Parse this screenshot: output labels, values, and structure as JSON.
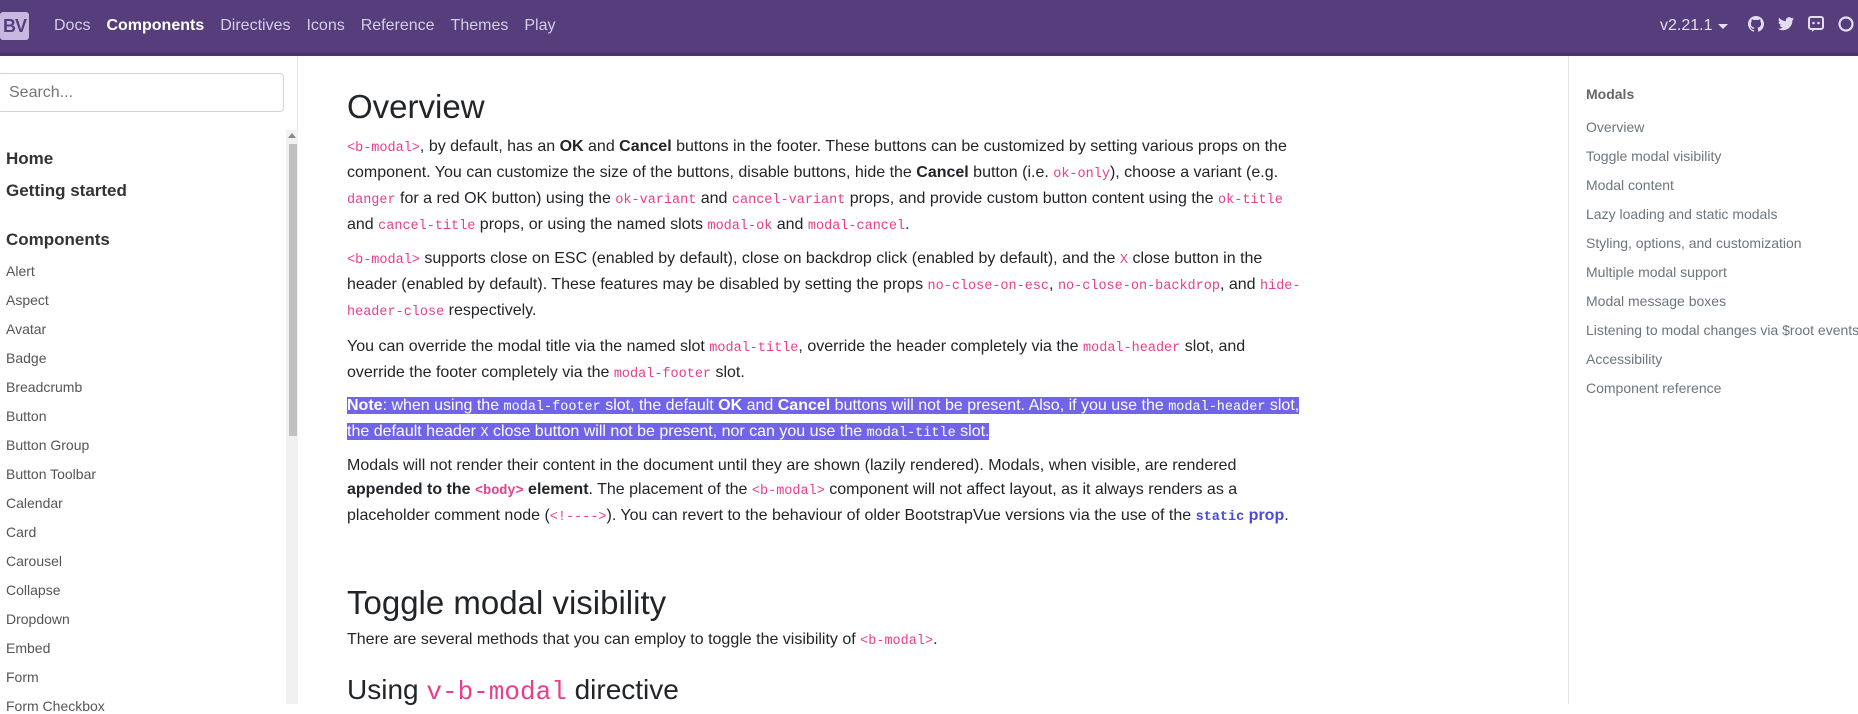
{
  "navbar": {
    "brand": "BV",
    "links": [
      "Docs",
      "Components",
      "Directives",
      "Icons",
      "Reference",
      "Themes",
      "Play"
    ],
    "active_link": "Components",
    "version": "v2.21.1",
    "icons": [
      "github-icon",
      "twitter-icon",
      "discord-icon",
      "opencollective-icon"
    ]
  },
  "sidebar": {
    "search_placeholder": "Search...",
    "top_links": [
      "Home",
      "Getting started"
    ],
    "section_title": "Components",
    "items": [
      "Alert",
      "Aspect",
      "Avatar",
      "Badge",
      "Breadcrumb",
      "Button",
      "Button Group",
      "Button Toolbar",
      "Calendar",
      "Card",
      "Carousel",
      "Collapse",
      "Dropdown",
      "Embed",
      "Form",
      "Form Checkbox"
    ]
  },
  "content": {
    "overview_title": "Overview",
    "p1": {
      "c_b_modal": "<b-modal>",
      "t1": ", by default, has an ",
      "ok": "OK",
      "and": " and ",
      "cancel": "Cancel",
      "t2": " buttons in the footer. These buttons can be customized by setting various props on the component. You can customize the size of the buttons, disable buttons, hide the ",
      "cancel2": "Cancel",
      "t3": " button (i.e. ",
      "c_ok_only": "ok-only",
      "t4": "), choose a variant (e.g. ",
      "c_danger": "danger",
      "t5": " for a red OK button) using the ",
      "c_ok_variant": "ok-variant",
      "t6": " and ",
      "c_cancel_variant": "cancel-variant",
      "t7": " props, and provide custom button content using the ",
      "c_ok_title": "ok-title",
      "t8": " and ",
      "c_cancel_title": "cancel-title",
      "t9": " props, or using the named slots ",
      "c_modal_ok": "modal-ok",
      "t10": " and ",
      "c_modal_cancel": "modal-cancel",
      "t11": "."
    },
    "p2": {
      "c_b_modal": "<b-modal>",
      "t1": " supports close on ESC (enabled by default), close on backdrop click (enabled by default), and the ",
      "c_x": "X",
      "t2": " close button in the header (enabled by default). These features may be disabled by setting the props ",
      "c_no_close_esc": "no-close-on-esc",
      "t3": ", ",
      "c_no_close_backdrop": "no-close-on-backdrop",
      "t4": ", and ",
      "c_hide_header_close": "hide-header-close",
      "t5": " respectively."
    },
    "p3": {
      "t1": "You can override the modal title via the named slot ",
      "c_modal_title": "modal-title",
      "t2": ", override the header completely via the ",
      "c_modal_header": "modal-header",
      "t3": " slot, and override the footer completely via the ",
      "c_modal_footer": "modal-footer",
      "t4": " slot."
    },
    "p4": {
      "note": "Note",
      "t1": ": when using the ",
      "c_modal_footer": "modal-footer",
      "t2": " slot, the default ",
      "ok": "OK",
      "and": " and ",
      "cancel": "Cancel",
      "t3": " buttons will not be present. Also, if you use the ",
      "c_modal_header": "modal-header",
      "t4": " slot, the default header ",
      "c_x": "X",
      "t5": " close button will not be present, nor can you use the ",
      "c_modal_title": "modal-title",
      "t6": " slot."
    },
    "p5": {
      "t1": "Modals will not render their content in the document until they are shown (lazily rendered). Modals, when visible, are rendered ",
      "b1": "appended to the ",
      "c_body": "<body>",
      "b2": " element",
      "t2": ". The placement of the ",
      "c_b_modal": "<b-modal>",
      "t3": " component will not affect layout, as it always renders as a placeholder comment node (",
      "c_comment": "<!---->",
      "t4": "). You can revert to the behaviour of older BootstrapVue versions via the use of the ",
      "c_static": "static",
      "prop": " prop",
      "t5": "."
    },
    "toggle_title": "Toggle modal visibility",
    "p6": {
      "t1": "There are several methods that you can employ to toggle the visibility of ",
      "c_b_modal": "<b-modal>",
      "t2": "."
    },
    "using_title_pre": "Using ",
    "using_title_code": "v-b-modal",
    "using_title_post": " directive"
  },
  "toc": {
    "title": "Modals",
    "items": [
      "Overview",
      "Toggle modal visibility",
      "Modal content",
      "Lazy loading and static modals",
      "Styling, options, and customization",
      "Multiple modal support",
      "Modal message boxes",
      "Listening to modal changes via $root events",
      "Accessibility",
      "Component reference"
    ]
  },
  "colors": {
    "navbar": "#563d7c",
    "code": "#e83e8c",
    "selection": "#7064e8"
  }
}
